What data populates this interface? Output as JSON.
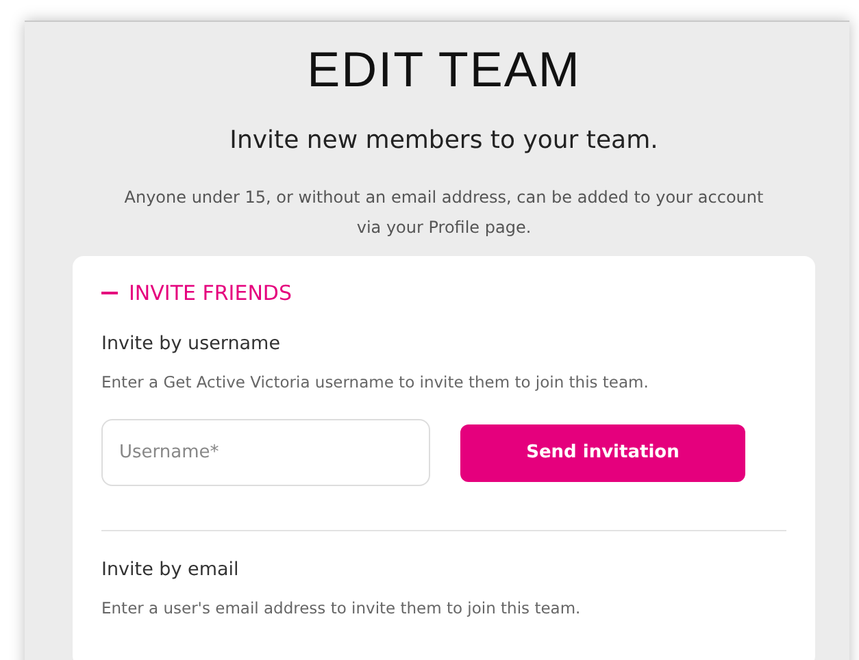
{
  "header": {
    "title": "EDIT TEAM",
    "subtitle": "Invite new members to your team.",
    "description": "Anyone under 15, or without an email address, can be added to your account via your Profile page."
  },
  "section": {
    "title": "INVITE FRIENDS",
    "expanded": true,
    "groups": [
      {
        "heading": "Invite by username",
        "text": "Enter a Get Active Victoria username to invite them to join this team.",
        "placeholder": "Username*",
        "button": "Send invitation"
      },
      {
        "heading": "Invite by email",
        "text": "Enter a user's email address to invite them to join this team."
      }
    ]
  }
}
